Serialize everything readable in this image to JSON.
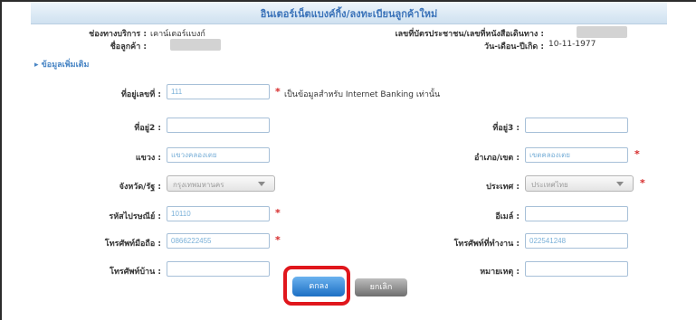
{
  "title": "อินเตอร์เน็ตแบงค์กิ้ง/ลงทะเบียนลูกค้าใหม่",
  "header": {
    "channel_label": "ช่องทางบริการ :",
    "channel_value": "เคาน์เตอร์แบงก์",
    "customer_name_label": "ชื่อลูกค้า :",
    "id_label": "เลขที่บัตรประชาชน/เลขที่หนังสือเดินทาง :",
    "dob_label": "วัน-เดือน-ปีเกิด :",
    "dob_value": "10-11-1977"
  },
  "section_label": "ข้อมูลเพิ่มเติม",
  "form": {
    "address_no": {
      "label": "ที่อยู่เลขที่ :",
      "value": "111",
      "note": "เป็นข้อมูลสำหรับ Internet Banking เท่านั้น"
    },
    "address2": {
      "label": "ที่อยู่2 :",
      "value": ""
    },
    "address3": {
      "label": "ที่อยู่3 :",
      "value": ""
    },
    "subdistrict": {
      "label": "แขวง :",
      "value": "แขวงคลองเตย"
    },
    "district": {
      "label": "อำเภอ/เขต :",
      "value": "เขตคลองเตย"
    },
    "province": {
      "label": "จังหวัด/รัฐ :",
      "value": "กรุงเทพมหานคร"
    },
    "country": {
      "label": "ประเทศ :",
      "value": "ประเทศไทย"
    },
    "postcode": {
      "label": "รหัสไปรษณีย์ :",
      "value": "10110"
    },
    "email": {
      "label": "อีเมล์ :",
      "value": ""
    },
    "mobile": {
      "label": "โทรศัพท์มือถือ :",
      "value": "0866222455"
    },
    "work_phone": {
      "label": "โทรศัพท์ที่ทำงาน :",
      "value": "022541248"
    },
    "home_phone": {
      "label": "โทรศัพท์บ้าน :",
      "value": ""
    },
    "remark": {
      "label": "หมายเหตุ :",
      "value": ""
    }
  },
  "required_mark": "*",
  "buttons": {
    "save": "ตกลง",
    "cancel": "ยกเลิก"
  },
  "colors": {
    "title": "#3b73b9",
    "highlight": "#e0161c",
    "save_button": "#1c6fc4"
  }
}
